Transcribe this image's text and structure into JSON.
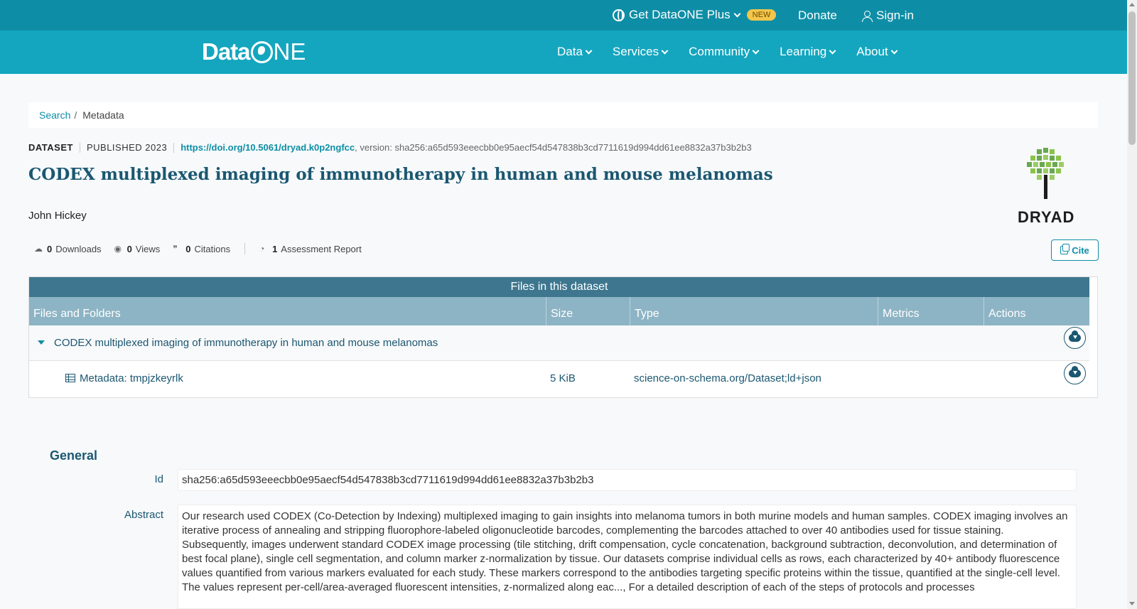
{
  "topbar": {
    "plus_label": "Get DataONE Plus",
    "new_badge": "NEW",
    "donate": "Donate",
    "signin": "Sign-in"
  },
  "navbar": {
    "logo_text_a": "Data",
    "logo_text_b": "NE",
    "items": [
      {
        "label": "Data"
      },
      {
        "label": "Services"
      },
      {
        "label": "Community"
      },
      {
        "label": "Learning"
      },
      {
        "label": "About"
      }
    ]
  },
  "breadcrumb": {
    "search": "Search",
    "sep": "/",
    "current": "Metadata"
  },
  "dataset": {
    "type_label": "DATASET",
    "published": "PUBLISHED 2023",
    "doi": "https://doi.org/10.5061/dryad.k0p2ngfcc",
    "version": ", version: sha256:a65d593eeecbb0e95aecf54d547838b3cd7711619d994dd61ee8832a37b3b2b3",
    "title": "CODEX multiplexed imaging of immunotherapy in human and mouse melanomas",
    "author": "John Hickey",
    "repository_logo_text": "DRYAD"
  },
  "stats": {
    "downloads_count": "0",
    "downloads_label": "Downloads",
    "views_count": "0",
    "views_label": "Views",
    "citations_count": "0",
    "citations_label": "Citations",
    "assessment_count": "1",
    "assessment_label": "Assessment Report"
  },
  "cite_label": "Cite",
  "files": {
    "heading": "Files in this dataset",
    "columns": [
      "Files and Folders",
      "Size",
      "Type",
      "Metrics",
      "Actions"
    ],
    "folder_name": "CODEX multiplexed imaging of immunotherapy in human and mouse melanomas",
    "file": {
      "name": "Metadata: tmpjzkeyrlk",
      "size": "5 KiB",
      "type": "science-on-schema.org/Dataset;ld+json"
    }
  },
  "general": {
    "heading": "General",
    "id_label": "Id",
    "id_value": "sha256:a65d593eeecbb0e95aecf54d547838b3cd7711619d994dd61ee8832a37b3b2b3",
    "abstract_label": "Abstract",
    "abstract_value": "Our research used CODEX (Co-Detection by Indexing) multiplexed imaging to gain insights into melanoma tumors in both murine models and human samples. CODEX imaging involves an iterative process of annealing and stripping fluorophore-labeled oligonucleotide barcodes, complementing the barcodes attached to over 40 antibodies used for tissue staining. Subsequently, images underwent standard CODEX image processing (tile stitching, drift compensation, cycle concatenation, background subtraction, deconvolution, and determination of best focal plane), single cell segmentation, and column marker z-normalization by tissue. Our datasets comprise individual cells as rows, each characterized by 40+ antibody fluorescence values quantified from various markers evaluated for each study. These markers correspond to the antibodies targeting specific proteins within the tissue, quantified at the single-cell level. The values represent per-cell/area-averaged fluorescent intensities, z-normalized along eac..., For a detailed description of each of the steps of protocols and processes"
  },
  "colors": {
    "topbar": "#0e8ea6",
    "navbar": "#14a6bf",
    "title": "#1b5770",
    "link": "#0e8ea6",
    "files_header": "#3d768e",
    "columns_header": "#8db4c4"
  }
}
